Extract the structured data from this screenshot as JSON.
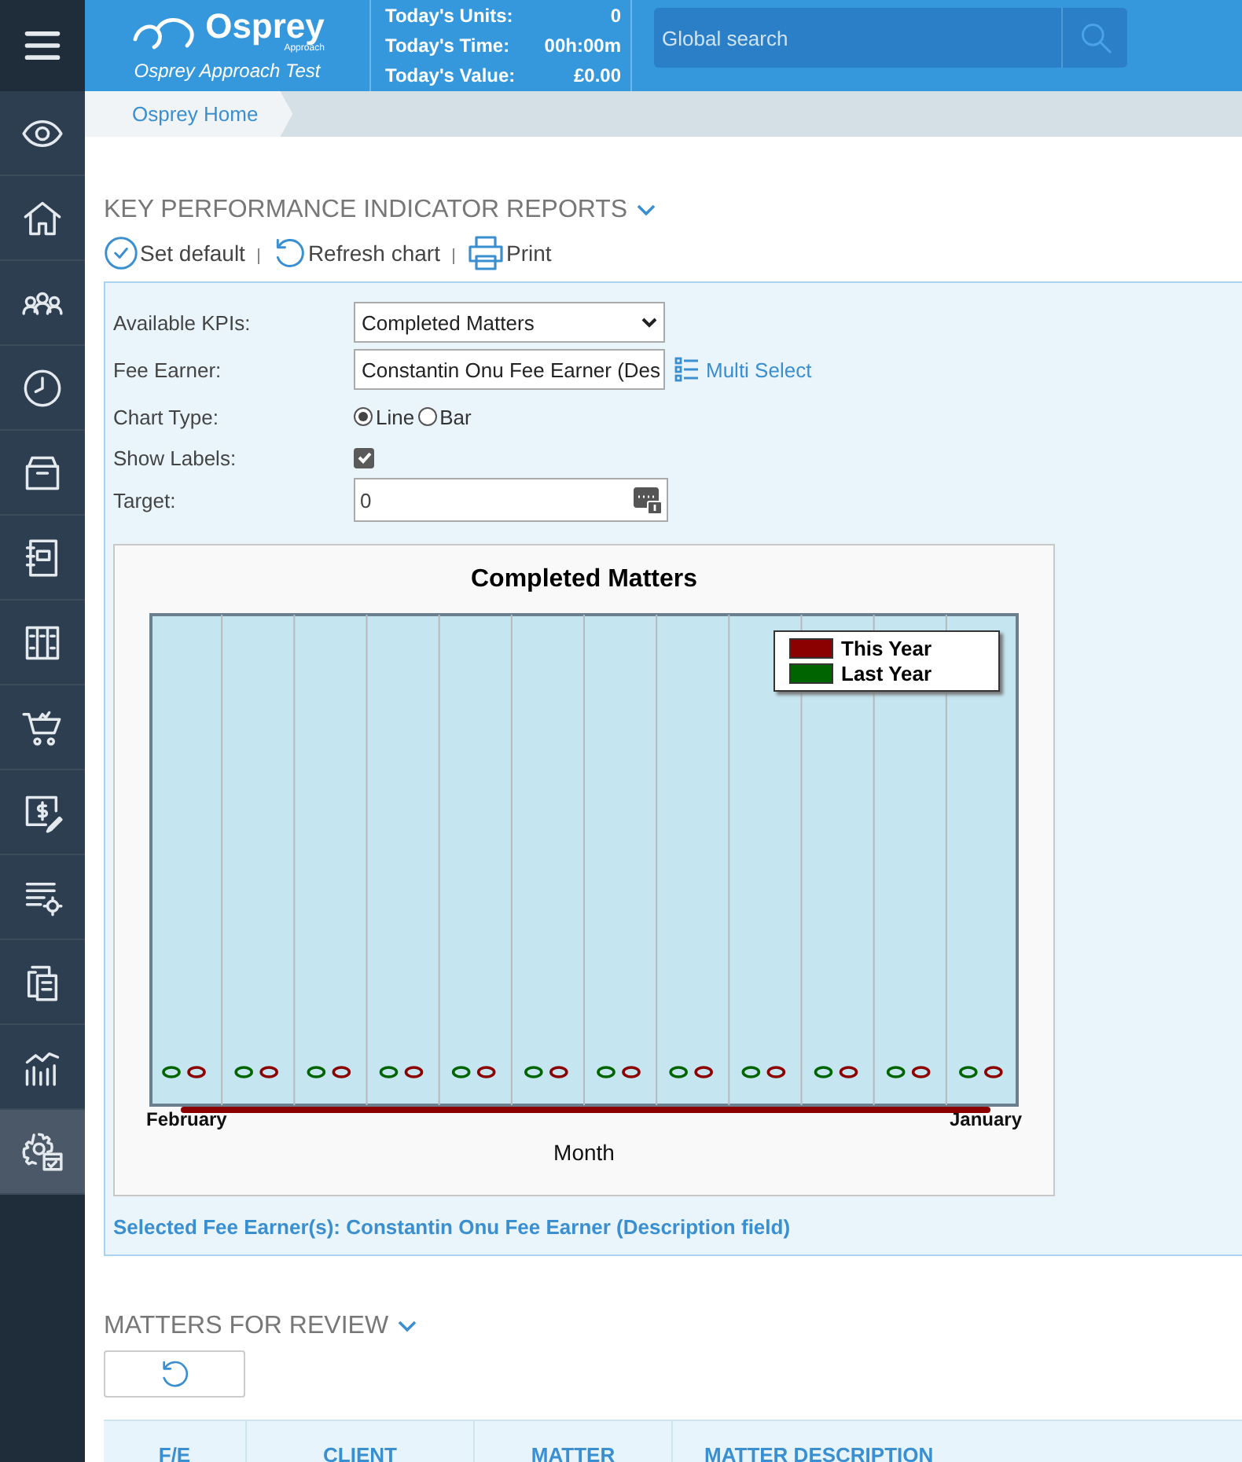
{
  "sidebar": {
    "items": [
      {
        "kind": "menu",
        "selected": false
      },
      {
        "kind": "eye",
        "selected": false
      },
      {
        "kind": "home",
        "selected": false
      },
      {
        "kind": "people",
        "selected": false
      },
      {
        "kind": "clock",
        "selected": false
      },
      {
        "kind": "box",
        "selected": false
      },
      {
        "kind": "notebook",
        "selected": false
      },
      {
        "kind": "books",
        "selected": false
      },
      {
        "kind": "cart",
        "selected": false
      },
      {
        "kind": "invoice",
        "selected": false
      },
      {
        "kind": "list-settings",
        "selected": false
      },
      {
        "kind": "documents",
        "selected": false
      },
      {
        "kind": "chart",
        "selected": false
      },
      {
        "kind": "settings",
        "selected": true
      }
    ]
  },
  "header": {
    "logo": {
      "name": "Osprey",
      "tagline": "Approach",
      "subtitle": "Osprey Approach Test"
    },
    "stats": [
      {
        "label": "Today's Units:",
        "value": "0"
      },
      {
        "label": "Today's Time:",
        "value": "00h:00m"
      },
      {
        "label": "Today's Value:",
        "value": "£0.00"
      }
    ],
    "search": {
      "placeholder": "Global search"
    }
  },
  "breadcrumb": [
    "Osprey Home"
  ],
  "kpi": {
    "title": "KEY PERFORMANCE INDICATOR REPORTS",
    "toolbar": [
      {
        "kind": "check",
        "label": "Set default"
      },
      {
        "kind": "refresh",
        "label": "Refresh chart"
      },
      {
        "kind": "print",
        "label": "Print"
      }
    ],
    "form": {
      "available_kpis": {
        "label": "Available KPIs:",
        "value": "Completed Matters"
      },
      "fee_earner": {
        "label": "Fee Earner:",
        "value": "Constantin Onu Fee Earner (Des",
        "link": "Multi Select"
      },
      "chart_type": {
        "label": "Chart Type:",
        "options": [
          {
            "label": "Line",
            "selected": true
          },
          {
            "label": "Bar",
            "selected": false
          }
        ]
      },
      "show_labels": {
        "label": "Show Labels:",
        "checked": true
      },
      "target": {
        "label": "Target:",
        "value": "0"
      }
    },
    "chart": {
      "title": "Completed Matters",
      "legend": [
        {
          "label": "This Year",
          "color": "#8b0000"
        },
        {
          "label": "Last Year",
          "color": "#006400"
        }
      ],
      "x_labels": [
        "February",
        "January"
      ],
      "xlabel": "Month"
    },
    "selection": "Selected Fee Earner(s): Constantin Onu Fee Earner (Description field)"
  },
  "matters": {
    "title": "MATTERS FOR REVIEW",
    "columns": [
      "F/E",
      "CLIENT",
      "MATTER",
      "MATTER DESCRIPTION"
    ]
  }
}
